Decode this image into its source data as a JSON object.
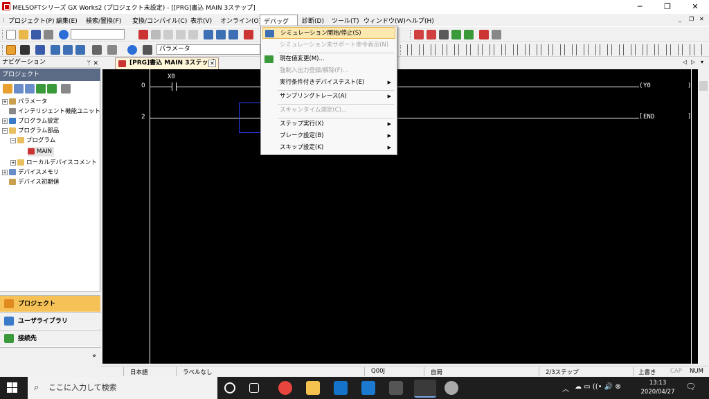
{
  "window": {
    "title": "MELSOFTシリーズ GX Works2 (プロジェクト未設定) - [[PRG]書込 MAIN 3ステップ]",
    "minimize": "─",
    "maximize": "❐",
    "close": "✕",
    "doc_min": "_",
    "doc_restore": "❐",
    "doc_close": "✕"
  },
  "menubar": {
    "items": [
      "プロジェクト(P)",
      "編集(E)",
      "検索/置換(F)",
      "変換/コンパイル(C)",
      "表示(V)",
      "オンライン(O)",
      "デバッグ(B)",
      "診断(D)",
      "ツール(T)",
      "ウィンドウ(W)",
      "ヘルプ(H)"
    ]
  },
  "toolbar": {
    "param_field": "パラメータ"
  },
  "navigation": {
    "header": "ナビゲーション",
    "pin": "ᛘ",
    "close": "✕",
    "section": "プロジェクト",
    "tree": [
      {
        "label": "パラメータ",
        "exp": "+"
      },
      {
        "label": "インテリジェント機能ユニット",
        "exp": ""
      },
      {
        "label": "プログラム設定",
        "exp": "+"
      },
      {
        "label": "プログラム部品",
        "exp": "−"
      },
      {
        "label": "プログラム",
        "exp": "−"
      },
      {
        "label": "MAIN",
        "exp": ""
      },
      {
        "label": "ローカルデバイスコメント",
        "exp": "+"
      },
      {
        "label": "デバイスメモリ",
        "exp": "+"
      },
      {
        "label": "デバイス初期値",
        "exp": ""
      }
    ],
    "bottom": [
      "プロジェクト",
      "ユーザライブラリ",
      "接続先"
    ],
    "more": "»"
  },
  "tab": {
    "label": "[PRG]書込 MAIN 3ステップ",
    "close": "✕",
    "nav_prev": "◁",
    "nav_next": "▷",
    "nav_menu": "▾"
  },
  "ladder": {
    "rungs": [
      {
        "step": "0",
        "contact": "X0",
        "coil": "Y0"
      },
      {
        "step": "2",
        "coil": "END"
      }
    ]
  },
  "debug_menu": {
    "items": [
      {
        "label": "シミュレーション開始/停止(S)",
        "state": "highlighted"
      },
      {
        "label": "シミュレーション未サポート命令表示(N)",
        "state": "disabled"
      },
      {
        "label": "現在値変更(M)...",
        "state": "enabled"
      },
      {
        "label": "強制入出力登録/解除(F)...",
        "state": "disabled"
      },
      {
        "label": "実行条件付きデバイステスト(E)",
        "state": "enabled",
        "submenu": true
      },
      {
        "label": "サンプリングトレース(A)",
        "state": "enabled",
        "submenu": true
      },
      {
        "label": "スキャンタイム測定(C)...",
        "state": "disabled"
      },
      {
        "label": "ステップ実行(X)",
        "state": "enabled",
        "submenu": true
      },
      {
        "label": "ブレーク設定(B)",
        "state": "enabled",
        "submenu": true
      },
      {
        "label": "スキップ設定(K)",
        "state": "enabled",
        "submenu": true
      }
    ]
  },
  "statusbar": {
    "language": "日本語",
    "label": "ラベルなし",
    "cpu": "Q00J",
    "station": "自局",
    "steps": "2/3ステップ",
    "mode": "上書き",
    "caps": "CAP",
    "num": "NUM"
  },
  "taskbar": {
    "search_placeholder": "ここに入力して検索",
    "time": "13:13",
    "date": "2020/04/27",
    "tray_up": "︿",
    "tray_icons": "☁ ▭ ((• 🔊 ⊗",
    "notification": "🗨"
  }
}
